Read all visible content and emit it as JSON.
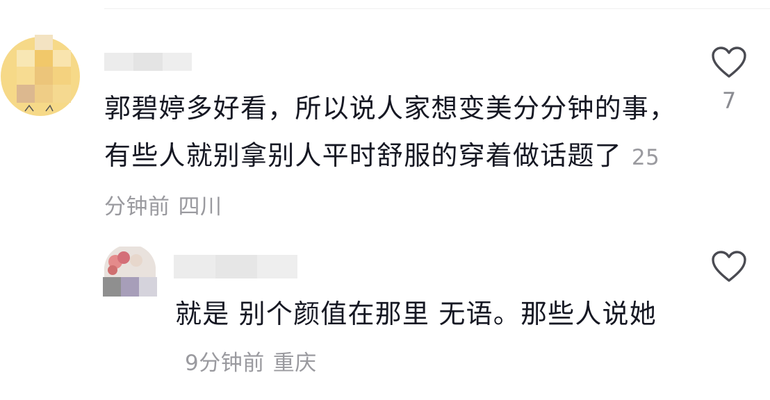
{
  "comments": [
    {
      "text": "郭碧婷多好看，所以说人家想变美分分钟的事，有些人就别拿别人平时舒服的穿着做话题了",
      "time": "25分钟前",
      "location": "四川",
      "likes": "7"
    },
    {
      "text": "就是 别个颜值在那里 无语。那些人说她",
      "time": "9分钟前",
      "location": "重庆",
      "likes": ""
    }
  ],
  "icons": {
    "like": "heart-outline-icon"
  },
  "colors": {
    "text": "#161823",
    "meta": "#9a9a9f",
    "icon": "#4a4b52",
    "avatar_main": "#f3d27a"
  }
}
